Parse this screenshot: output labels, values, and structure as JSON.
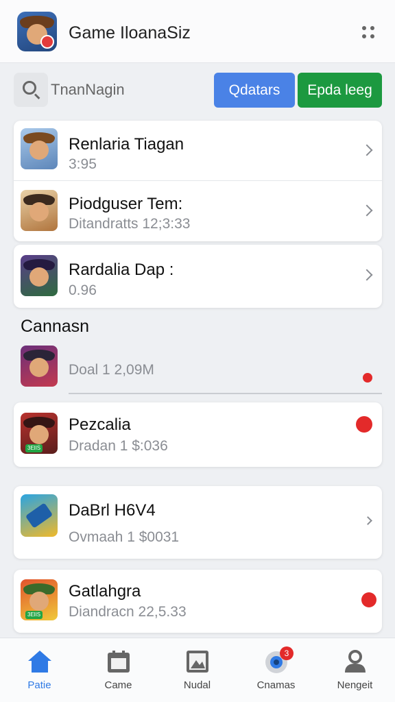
{
  "header": {
    "title": "Game IloanaSiz",
    "menu_icon": "more-dots-icon"
  },
  "search": {
    "placeholder": "TnanNagin",
    "buttons": [
      {
        "label": "Qdatars",
        "color": "#4a82e6"
      },
      {
        "label": "Epda leeg",
        "color": "#1c9940"
      }
    ]
  },
  "list_primary": [
    {
      "title": "Renlaria Tiagan",
      "subtitle": "3:95"
    },
    {
      "title": "Piodguser Tem:",
      "subtitle": "Ditandratts 12;3:33"
    },
    {
      "title": "Rardalia Dap :",
      "subtitle": "0.96"
    }
  ],
  "section": {
    "label": "Cannasn"
  },
  "plain_item": {
    "subtitle": "Doal 1 2,09M"
  },
  "list_secondary": [
    {
      "title": "Pezcalia",
      "subtitle": "Dradan 1 $:036",
      "tag": "3ElIS"
    },
    {
      "title": "DaBrl H6V4",
      "subtitle": "Ovmaah 1 $0031"
    },
    {
      "title": "Gatlahgra",
      "subtitle": "Diandracn 22,5.33",
      "tag": "3ElIS"
    }
  ],
  "nav": [
    {
      "label": "Patie",
      "icon": "home-icon",
      "active": true
    },
    {
      "label": "Came",
      "icon": "calendar-icon"
    },
    {
      "label": "Nudal",
      "icon": "image-icon"
    },
    {
      "label": "Cnamas",
      "icon": "globe-icon",
      "badge": "3"
    },
    {
      "label": "Nengeit",
      "icon": "user-icon"
    }
  ],
  "colors": {
    "accent": "#2f7ae5",
    "alert": "#e32a2a"
  }
}
